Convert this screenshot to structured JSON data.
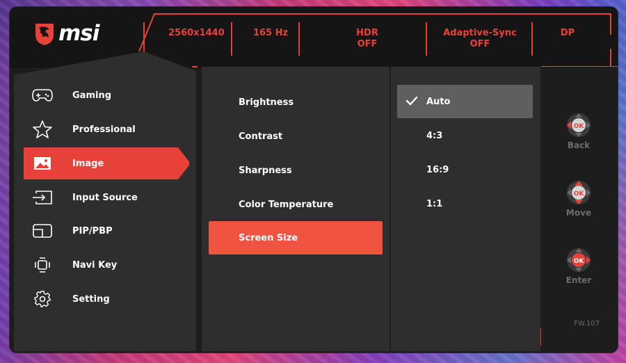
{
  "brand": "msi",
  "status_bar": {
    "resolution": "2560x1440",
    "refresh_rate": "165 Hz",
    "hdr_label": "HDR",
    "hdr_value": "OFF",
    "adaptive_sync_label": "Adaptive-Sync",
    "adaptive_sync_value": "OFF",
    "input": "DP"
  },
  "main_menu": [
    {
      "label": "Gaming",
      "icon": "gamepad-icon"
    },
    {
      "label": "Professional",
      "icon": "star-icon"
    },
    {
      "label": "Image",
      "icon": "image-icon",
      "active": true
    },
    {
      "label": "Input Source",
      "icon": "input-source-icon"
    },
    {
      "label": "PIP/PBP",
      "icon": "pip-icon"
    },
    {
      "label": "Navi Key",
      "icon": "navi-key-icon"
    },
    {
      "label": "Setting",
      "icon": "gear-icon"
    }
  ],
  "image_menu": [
    {
      "label": "Brightness"
    },
    {
      "label": "Contrast"
    },
    {
      "label": "Sharpness"
    },
    {
      "label": "Color Temperature"
    },
    {
      "label": "Screen Size",
      "active": true
    }
  ],
  "screen_size_options": [
    {
      "label": "Auto",
      "selected": true
    },
    {
      "label": "4:3"
    },
    {
      "label": "16:9"
    },
    {
      "label": "1:1"
    }
  ],
  "nav_keys": [
    {
      "caption": "Back",
      "center": "OK",
      "icon": "joystick-left-icon"
    },
    {
      "caption": "Move",
      "center": "OK",
      "icon": "joystick-updown-icon"
    },
    {
      "caption": "Enter",
      "center": "OK",
      "icon": "joystick-right-icon"
    }
  ],
  "firmware": "FW.107",
  "colors": {
    "accent": "#e8413a",
    "panel": "#2e2e2f",
    "frame": "#151516",
    "selected_option": "#5f5f60"
  }
}
